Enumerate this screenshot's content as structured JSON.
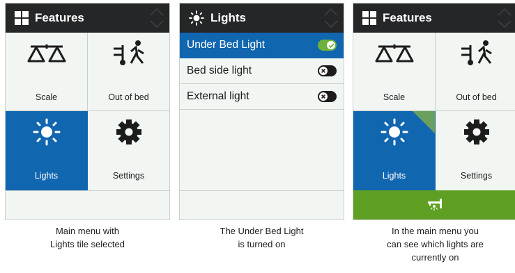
{
  "screens": [
    {
      "title": "Features",
      "tiles": [
        "Scale",
        "Out of bed",
        "Lights",
        "Settings"
      ],
      "selected_tile": "Lights",
      "caption": [
        "Main menu with",
        "Lights tile selected"
      ]
    },
    {
      "title": "Lights",
      "items": [
        {
          "label": "Under Bed Light",
          "state": "on",
          "selected": true
        },
        {
          "label": "Bed side light",
          "state": "off",
          "selected": false
        },
        {
          "label": "External light",
          "state": "off",
          "selected": false
        }
      ],
      "caption": [
        "The Under Bed Light",
        "is turned on"
      ]
    },
    {
      "title": "Features",
      "tiles": [
        "Scale",
        "Out of bed",
        "Lights",
        "Settings"
      ],
      "selected_tile": "Lights",
      "status_bar": "lights-on",
      "caption": [
        "In the main menu you",
        "can see which lights are",
        "currently on"
      ]
    }
  ],
  "colors": {
    "header": "#252628",
    "selected": "#1166b0",
    "toggle_on": "#6db23a",
    "status_on": "#5fa024",
    "background": "#f2f6f3"
  },
  "icons": [
    "grid-icon",
    "sun-icon",
    "scale-icon",
    "out-of-bed-icon",
    "gear-icon",
    "bed-light-icon",
    "check-icon",
    "x-icon",
    "scroll-arrows-icon"
  ]
}
